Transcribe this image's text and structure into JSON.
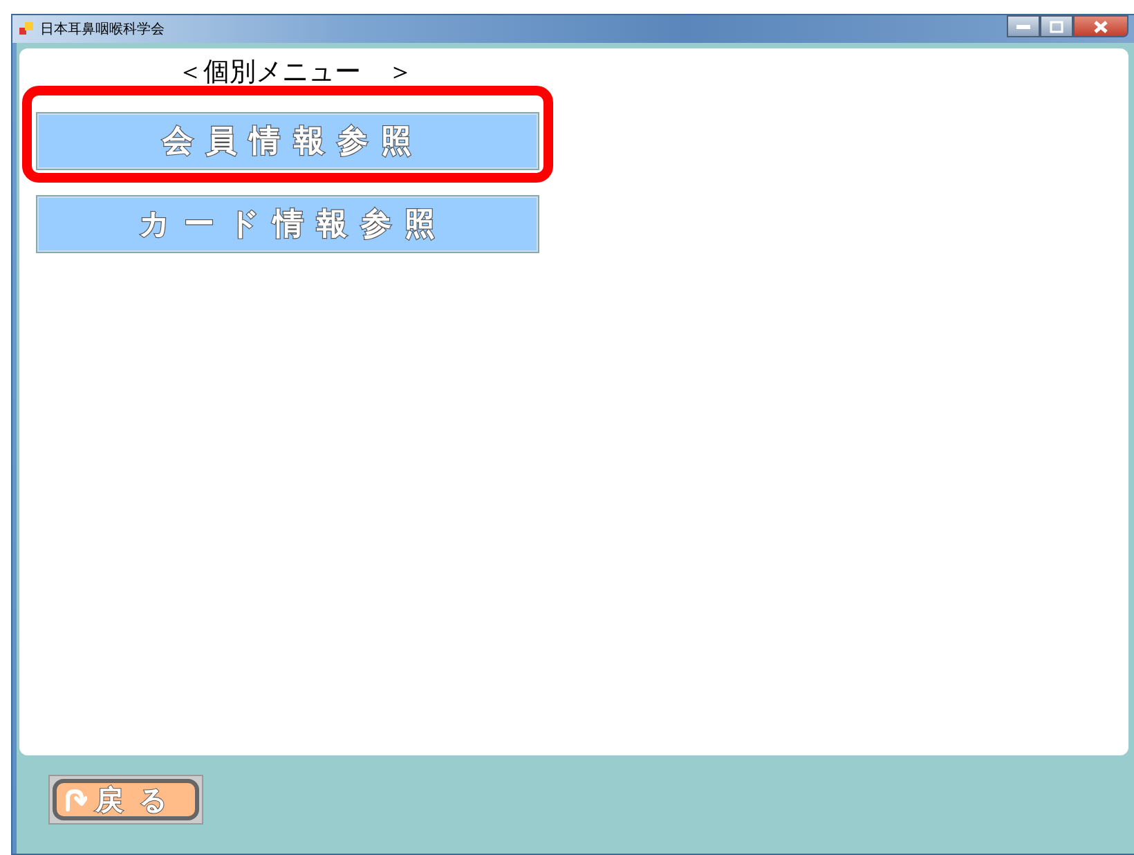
{
  "window": {
    "title": "日本耳鼻咽喉科学会"
  },
  "heading": "＜個別メニュー　＞",
  "menu_items": [
    {
      "label": "会 員 情 報 参 照",
      "highlighted": true
    },
    {
      "label": "カ ー ド 情 報 参 照",
      "highlighted": false
    }
  ],
  "back_button": {
    "label": "戻 る"
  }
}
